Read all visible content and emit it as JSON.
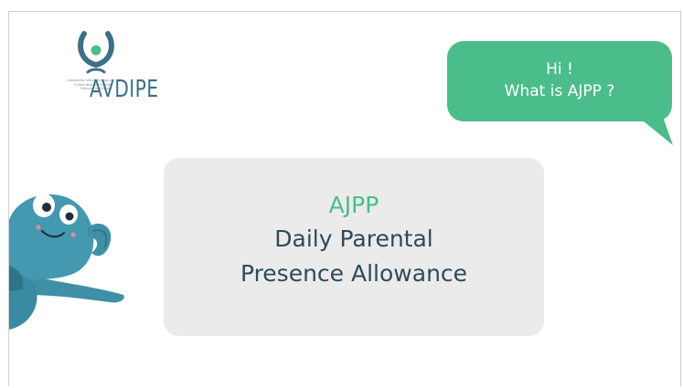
{
  "logo": {
    "wordmark": "AVDIPE",
    "tagline": "Association Vendéenne pour\nle Bien-être des Enfants\nPrécoces ou Enfants",
    "icon": "avdipe-person-icon"
  },
  "bubble": {
    "line1": "Hi !",
    "line2": "What is AJPP ?"
  },
  "card": {
    "acronym": "AJPP",
    "line1": "Daily Parental",
    "line2": "Presence Allowance"
  },
  "mascot": {
    "icon": "blue-character-icon"
  },
  "colors": {
    "accent_green": "#4bbd8b",
    "text_dark": "#2f4a5a",
    "card_bg": "#ebebeb",
    "mascot_blue": "#3f8fa6",
    "logo_blue": "#3d6f86"
  }
}
